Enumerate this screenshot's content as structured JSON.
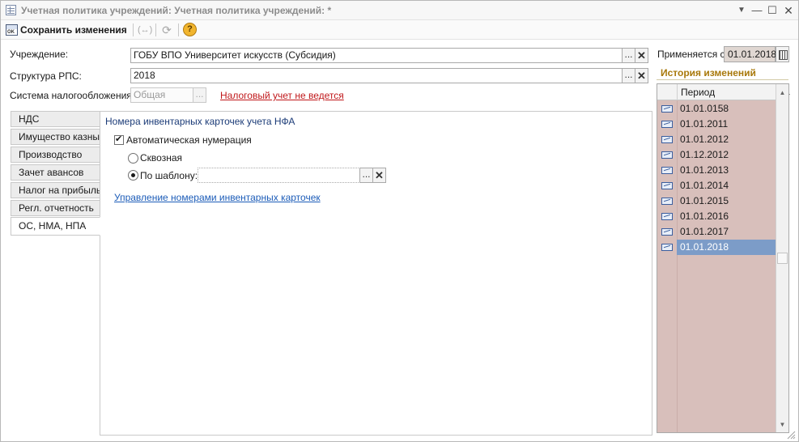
{
  "window": {
    "title": "Учетная политика учреждений: Учетная политика учреждений: *",
    "menu_glyph": "▼",
    "minimize_glyph": "—",
    "maximize_glyph": "☐",
    "close_glyph": "✕"
  },
  "toolbar": {
    "save_label": "Сохранить изменения",
    "arrows_glyph": "(↔)",
    "refresh_glyph": "⟳",
    "help_glyph": "?"
  },
  "form": {
    "institution_label": "Учреждение:",
    "institution_value": "ГОБУ ВПО Университет искусств (Субсидия)",
    "structure_label": "Структура РПС:",
    "structure_value": "2018",
    "tax_system_label": "Система налогообложения:",
    "tax_system_value": "Общая",
    "tax_accounting_link": "Налоговый учет не ведется",
    "select_button": "...",
    "clear_button": "✕"
  },
  "tabs": [
    {
      "label": "НДС"
    },
    {
      "label": "Имущество казны"
    },
    {
      "label": "Производство"
    },
    {
      "label": "Зачет авансов"
    },
    {
      "label": "Налог на прибыль"
    },
    {
      "label": "Регл. отчетность"
    },
    {
      "label": "ОС, НМА, НПА"
    }
  ],
  "panel": {
    "group_title": "Номера инвентарных карточек учета НФА",
    "auto_numbering_label": "Автоматическая нумерация",
    "auto_numbering_checked": true,
    "through_label": "Сквозная",
    "template_label": "По шаблону:",
    "template_value": "",
    "manage_link": "Управление номерами инвентарных карточек"
  },
  "right": {
    "applies_label": "Применяется с:",
    "applies_value": "01.01.2018",
    "history_title": "История изменений",
    "period_header": "Период",
    "periods": [
      "01.01.0158",
      "01.01.2011",
      "01.01.2012",
      "01.12.2012",
      "01.01.2013",
      "01.01.2014",
      "01.01.2015",
      "01.01.2016",
      "01.01.2017",
      "01.01.2018"
    ],
    "selected_period": "01.01.2018",
    "scroll_up_glyph": "▲",
    "scroll_down_glyph": "▼"
  },
  "colors": {
    "history_bg": "#d8bfbb",
    "selected_row": "#7c9cc8",
    "link_red": "#c0171a",
    "link_blue": "#1c5cb8",
    "history_title": "#a8780a"
  }
}
